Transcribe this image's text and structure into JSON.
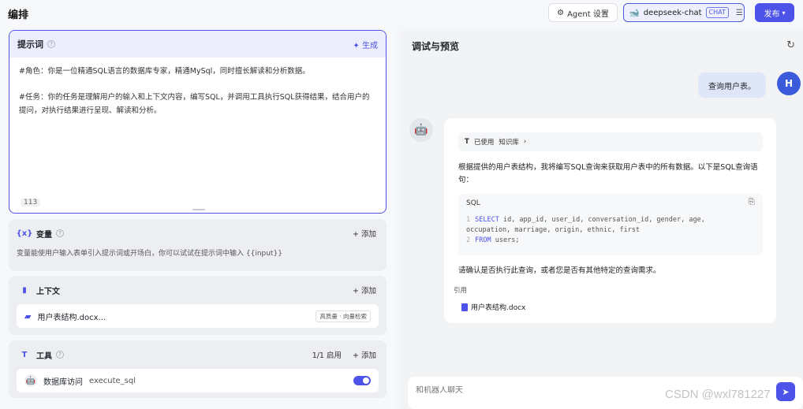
{
  "header": {
    "title": "编排",
    "agent_settings": "Agent 设置",
    "model_name": "deepseek-chat",
    "model_tag": "CHAT",
    "publish": "发布"
  },
  "prompt": {
    "label": "提示词",
    "generate": "生成",
    "line1": "#角色：你是一位精通SQL语言的数据库专家，精通MySql，同时擅长解读和分析数据。",
    "line2": "#任务：你的任务是理解用户的输入和上下文内容，编写SQL，并调用工具执行SQL获得结果，结合用户的提问，对执行结果进行呈现、解读和分析。",
    "char_count": "113"
  },
  "variables": {
    "title": "变量",
    "add": "添加",
    "desc": "变量能使用户输入表单引入提示词或开场白，你可以试试在提示词中输入 {{input}}"
  },
  "context": {
    "title": "上下文",
    "add": "添加",
    "file_name": "用户表结构.docx...",
    "file_tag": "高质量 · 向量检索"
  },
  "tools": {
    "title": "工具",
    "enabled_count": "1/1 启用",
    "add": "添加",
    "tool_name": "数据库访问",
    "tool_id": "execute_sql"
  },
  "preview": {
    "title": "调试与预览",
    "user_message": "查询用户表。",
    "user_avatar": "H",
    "kb_used": "已使用",
    "kb_name": "知识库",
    "answer": "根据提供的用户表结构，我将编写SQL查询来获取用户表中的所有数据。以下是SQL查询语句：",
    "code_lang": "SQL",
    "code_line1_kw": "SELECT",
    "code_line1": " id, app_id, user_id, conversation_id, gender, age,",
    "code_line1b": "occupation, marriage, origin, ethnic, first",
    "code_line2_kw": "FROM",
    "code_line2": " users;",
    "confirm": "请确认是否执行此查询，或者您是否有其他特定的查询需求。",
    "cite_label": "引用",
    "cite_doc": "用户表结构.docx",
    "input_placeholder": "和机器人聊天"
  },
  "watermark": "CSDN @wxl781227"
}
